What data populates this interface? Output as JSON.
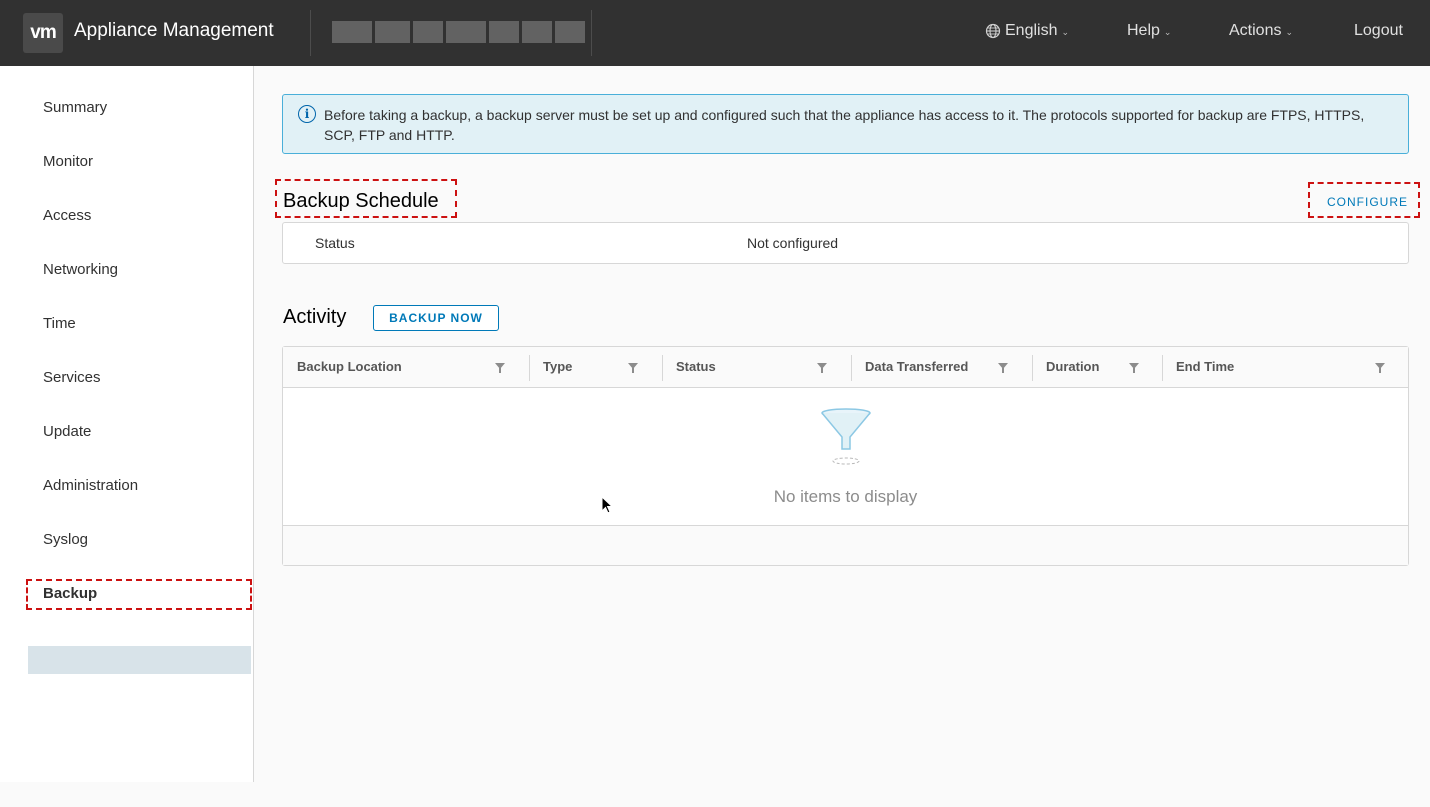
{
  "header": {
    "logo_text": "vm",
    "title": "Appliance Management",
    "language_label": "English",
    "help_label": "Help",
    "actions_label": "Actions",
    "logout_label": "Logout"
  },
  "sidebar": {
    "items": [
      {
        "label": "Summary"
      },
      {
        "label": "Monitor"
      },
      {
        "label": "Access"
      },
      {
        "label": "Networking"
      },
      {
        "label": "Time"
      },
      {
        "label": "Services"
      },
      {
        "label": "Update"
      },
      {
        "label": "Administration"
      },
      {
        "label": "Syslog"
      },
      {
        "label": "Backup"
      }
    ],
    "active": "Backup"
  },
  "alert": {
    "icon": "info-icon",
    "text": "Before taking a backup, a backup server must be set up and configured such that the appliance has access to it. The protocols supported for backup are FTPS, HTTPS, SCP, FTP and HTTP."
  },
  "schedule": {
    "title": "Backup Schedule",
    "configure_label": "CONFIGURE",
    "status_label": "Status",
    "status_value": "Not configured"
  },
  "activity": {
    "title": "Activity",
    "backup_now_label": "BACKUP NOW",
    "columns": [
      "Backup Location",
      "Type",
      "Status",
      "Data Transferred",
      "Duration",
      "End Time"
    ],
    "empty_text": "No items to display"
  },
  "colors": {
    "header_bg": "#313131",
    "accent": "#0079b8",
    "highlight_dash": "#cc1111",
    "alert_bg": "#e1f1f6"
  }
}
